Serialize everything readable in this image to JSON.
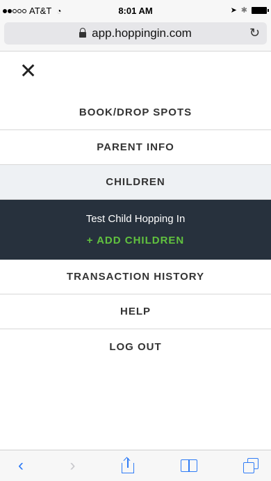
{
  "status_bar": {
    "carrier": "AT&T",
    "time": "8:01 AM"
  },
  "browser": {
    "url": "app.hoppingin.com"
  },
  "menu": {
    "items": [
      {
        "label": "BOOK/DROP SPOTS"
      },
      {
        "label": "PARENT INFO"
      },
      {
        "label": "CHILDREN"
      },
      {
        "label": "TRANSACTION HISTORY"
      },
      {
        "label": "HELP"
      },
      {
        "label": "LOG OUT"
      }
    ],
    "children_submenu": {
      "child_name": "Test Child Hopping In",
      "add_label": "+ ADD CHILDREN"
    }
  },
  "colors": {
    "submenu_bg": "#27313d",
    "accent_green": "#61c23f",
    "ios_blue": "#2f7cf6"
  },
  "icons": [
    "wifi-icon",
    "location-icon",
    "bluetooth-icon",
    "battery-icon",
    "lock-icon",
    "reload-icon",
    "close-icon",
    "back-icon",
    "forward-icon",
    "share-icon",
    "bookmarks-icon",
    "tabs-icon"
  ]
}
